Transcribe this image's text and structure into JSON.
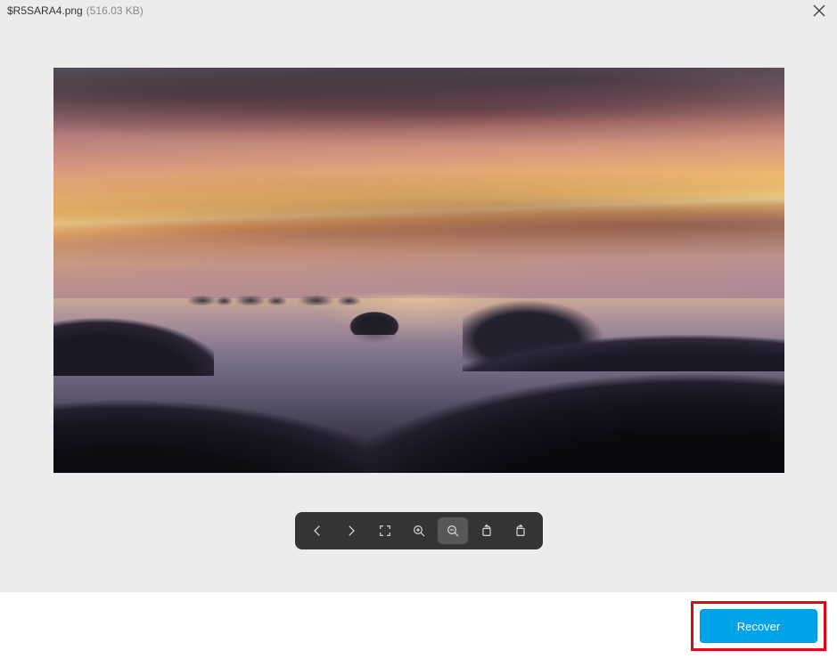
{
  "header": {
    "file_name": "$R5SARA4.png",
    "file_size": "(516.03 KB)"
  },
  "toolbar": {
    "prev": "Previous",
    "next": "Next",
    "fullscreen": "Fullscreen",
    "zoom_in": "Zoom In",
    "zoom_out": "Zoom Out",
    "rotate_cw": "Rotate Clockwise",
    "rotate_ccw": "Rotate Counter-clockwise"
  },
  "footer": {
    "recover_label": "Recover"
  }
}
